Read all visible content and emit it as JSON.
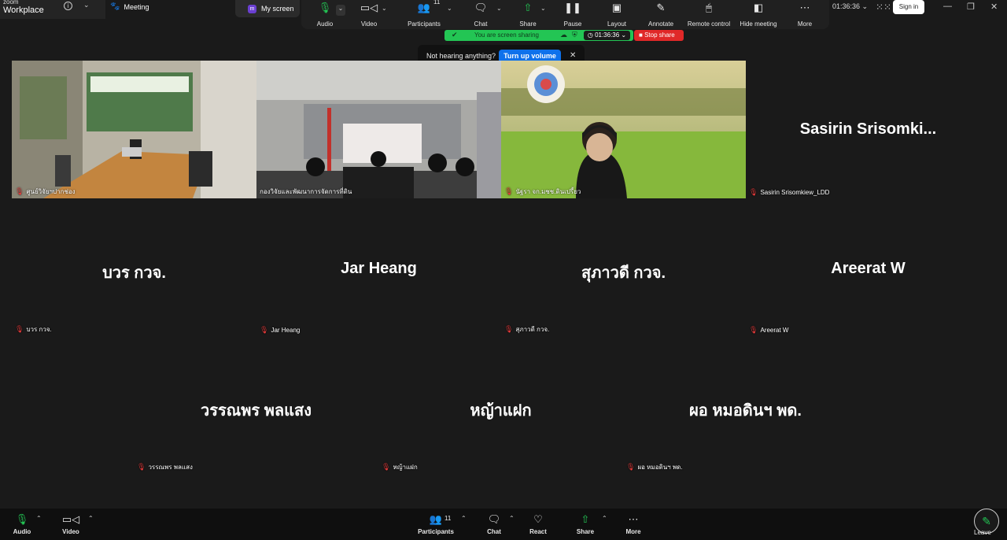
{
  "brand": {
    "small": "zoom",
    "main": "Workplace"
  },
  "meeting_tab": "Meeting",
  "my_screen": "My screen",
  "toolbar": {
    "audio": "Audio",
    "video": "Video",
    "participants": "Participants",
    "participants_count": "11",
    "chat": "Chat",
    "share": "Share",
    "pause": "Pause",
    "layout": "Layout",
    "annotate": "Annotate",
    "remote_control": "Remote control",
    "hide_meeting": "Hide meeting",
    "more": "More"
  },
  "timer": "01:36:36",
  "sign_in": "Sign in",
  "sharing": {
    "text": "You are screen sharing",
    "timer": "01:36:36",
    "stop": "Stop share"
  },
  "hearing": {
    "message": "Not hearing anything?",
    "button": "Turn up volume"
  },
  "tiles": [
    {
      "label": "ศูนย์วิจัยฯปากช่อง",
      "big": ""
    },
    {
      "label": "กองวิจัยและพัฒนาการจัดการที่ดิน",
      "big": ""
    },
    {
      "label": "นัฐรา จก.มชช.ดินเปรี้ยว",
      "big": ""
    },
    {
      "label": "Sasirin Srisomkiew_LDD",
      "big": "Sasirin  Srisomki..."
    },
    {
      "label": "บวร กวจ.",
      "big": "บวร กวจ."
    },
    {
      "label": "Jar Heang",
      "big": "Jar Heang"
    },
    {
      "label": "สุภาวดี กวจ.",
      "big": "สุภาวดี กวจ."
    },
    {
      "label": "Areerat W",
      "big": "Areerat W"
    },
    {
      "label": "วรรณพร พลแสง",
      "big": "วรรณพร พลแสง"
    },
    {
      "label": "หญ้าแฝก",
      "big": "หญ้าแฝก"
    },
    {
      "label": "ผอ หมอดินฯ พด.",
      "big": "ผอ หมอดินฯ พด."
    }
  ],
  "bottombar": {
    "audio": "Audio",
    "video": "Video",
    "participants": "Participants",
    "participants_count": "11",
    "chat": "Chat",
    "react": "React",
    "share": "Share",
    "more": "More",
    "leave": "Leave"
  },
  "colors": {
    "accent": "#23c554",
    "stop": "#e02828",
    "button_blue": "#0e71eb",
    "background": "#1a1a1a"
  }
}
